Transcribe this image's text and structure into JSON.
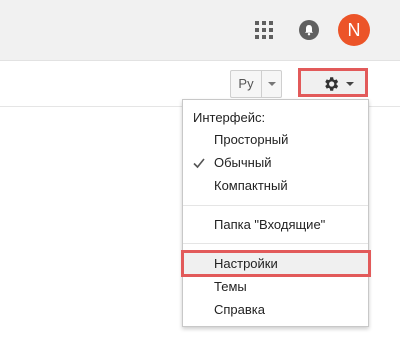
{
  "header": {
    "apps_icon": "apps-grid-icon",
    "notifications_icon": "bell-icon",
    "avatar_letter": "N",
    "avatar_color": "#ec5428"
  },
  "toolbar": {
    "language_label": "Ру",
    "settings_icon": "gear-icon"
  },
  "settings_menu": {
    "section_header": "Интерфейс:",
    "density_options": [
      {
        "label": "Просторный",
        "checked": false
      },
      {
        "label": "Обычный",
        "checked": true
      },
      {
        "label": "Компактный",
        "checked": false
      }
    ],
    "inbox_label": "Папка \"Входящие\"",
    "items": [
      {
        "label": "Настройки",
        "highlighted": true
      },
      {
        "label": "Темы",
        "highlighted": false
      },
      {
        "label": "Справка",
        "highlighted": false
      }
    ]
  },
  "highlight_color": "#e25a5a"
}
